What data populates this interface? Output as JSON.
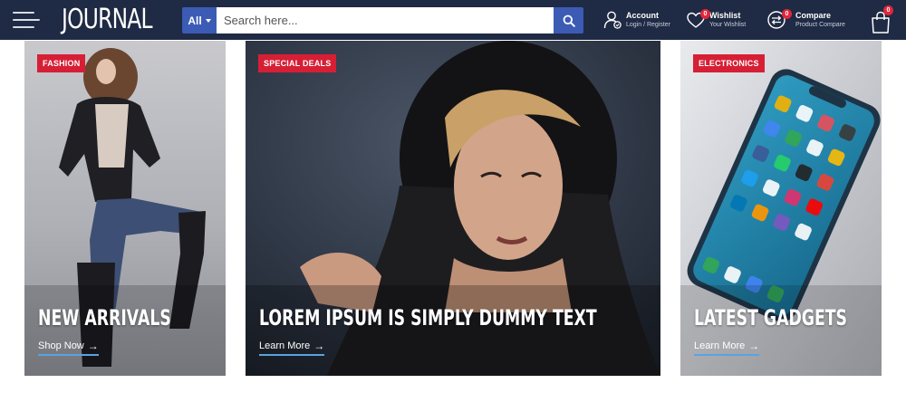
{
  "header": {
    "logo": "JOURNAL",
    "search": {
      "category_label": "All",
      "placeholder": "Search here..."
    },
    "account": {
      "title": "Account",
      "subtitle": "Login / Register"
    },
    "wishlist": {
      "title": "Wishlist",
      "subtitle": "Your Wishlist",
      "count": "0"
    },
    "compare": {
      "title": "Compare",
      "subtitle": "Product Compare",
      "count": "0"
    },
    "cart": {
      "count": "0"
    }
  },
  "banners": [
    {
      "tag": "FASHION",
      "title": "NEW ARRIVALS",
      "link": "Shop Now"
    },
    {
      "tag": "SPECIAL DEALS",
      "title": "LOREM IPSUM IS SIMPLY DUMMY TEXT",
      "link": "Learn More"
    },
    {
      "tag": "ELECTRONICS",
      "title": "LATEST GADGETS",
      "link": "Learn More"
    }
  ],
  "colors": {
    "header_bg": "#1f2a44",
    "accent_blue": "#3c5bb5",
    "tag_red": "#d61f35",
    "badge_red": "#e3263a",
    "link_underline": "#5aa3e0"
  },
  "icons": {
    "menu": "hamburger-icon",
    "search": "search-icon",
    "account": "user-icon",
    "wishlist": "heart-icon",
    "compare": "compare-arrows-icon",
    "cart": "shopping-bag-icon"
  }
}
